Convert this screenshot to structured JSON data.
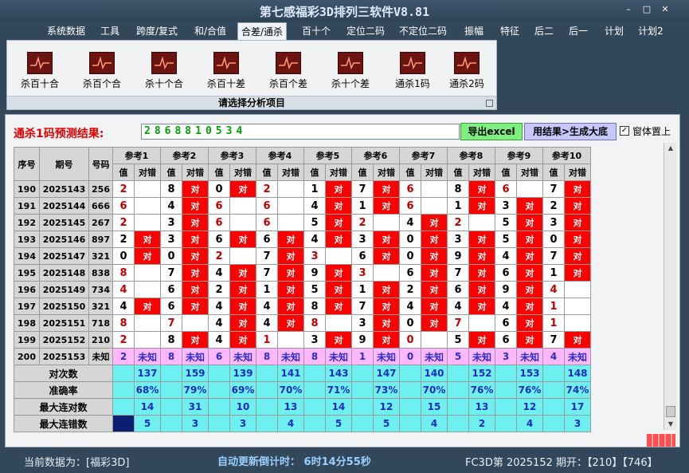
{
  "window": {
    "title": "第七感福彩3D排列三软件V8.81",
    "min_glyph": "–",
    "max_glyph": "□",
    "close_glyph": "✕"
  },
  "menu": [
    {
      "label": "系统数据"
    },
    {
      "label": "工具"
    },
    {
      "label": "跨度/复式"
    },
    {
      "label": "和/合值"
    },
    {
      "label": "合差/通杀",
      "active": true
    },
    {
      "label": "百十个"
    },
    {
      "label": "定位二码"
    },
    {
      "label": "不定位二码"
    },
    {
      "label": "振幅"
    },
    {
      "label": "特征"
    },
    {
      "label": "后二"
    },
    {
      "label": "后一"
    },
    {
      "label": "计划"
    },
    {
      "label": "计划2"
    }
  ],
  "ribbon": {
    "buttons": [
      {
        "label": "杀百十合",
        "icon": "chart-icon"
      },
      {
        "label": "杀百个合",
        "icon": "chart-icon"
      },
      {
        "label": "杀十个合",
        "icon": "chart-icon"
      },
      {
        "label": "杀百十差",
        "icon": "chart-icon"
      },
      {
        "label": "杀百个差",
        "icon": "chart-icon"
      },
      {
        "label": "杀十个差",
        "icon": "chart-icon"
      },
      {
        "label": "通杀1码",
        "icon": "chart-icon"
      },
      {
        "label": "通杀2码",
        "icon": "chart-icon"
      }
    ],
    "caption": "请选择分析项目"
  },
  "prediction": {
    "label": "通杀1码预测结果:",
    "value": "2868810534",
    "export_label": "导出excel",
    "generate_label": "用结果>生成大底",
    "always_on_top_label": "窗体置上",
    "always_on_top_checked": true
  },
  "table": {
    "headers": {
      "seq": "序号",
      "period": "期号",
      "code": "号码",
      "value": "值",
      "hit": "对错"
    },
    "refs": [
      "参考1",
      "参考2",
      "参考3",
      "参考4",
      "参考5",
      "参考6",
      "参考7",
      "参考8",
      "参考9",
      "参考10"
    ],
    "rows": [
      {
        "seq": "190",
        "period": "2025143",
        "code": "256",
        "cells": [
          [
            "2",
            "",
            ""
          ],
          [
            "8",
            "对",
            ""
          ],
          [
            "0",
            "对",
            ""
          ],
          [
            "2",
            "",
            ""
          ],
          [
            "1",
            "对",
            ""
          ],
          [
            "7",
            "对",
            ""
          ],
          [
            "6",
            "",
            ""
          ],
          [
            "8",
            "对",
            ""
          ],
          [
            "6",
            "",
            ""
          ],
          [
            "7",
            "对",
            ""
          ]
        ]
      },
      {
        "seq": "191",
        "period": "2025144",
        "code": "666",
        "cells": [
          [
            "6",
            "",
            ""
          ],
          [
            "4",
            "对",
            ""
          ],
          [
            "6",
            "",
            ""
          ],
          [
            "6",
            "",
            ""
          ],
          [
            "4",
            "对",
            ""
          ],
          [
            "1",
            "对",
            ""
          ],
          [
            "6",
            "",
            ""
          ],
          [
            "1",
            "对",
            ""
          ],
          [
            "3",
            "对",
            ""
          ],
          [
            "2",
            "对",
            ""
          ]
        ]
      },
      {
        "seq": "192",
        "period": "2025145",
        "code": "267",
        "cells": [
          [
            "2",
            "",
            ""
          ],
          [
            "3",
            "对",
            ""
          ],
          [
            "6",
            "",
            ""
          ],
          [
            "6",
            "",
            ""
          ],
          [
            "5",
            "对",
            ""
          ],
          [
            "2",
            "",
            ""
          ],
          [
            "4",
            "对",
            ""
          ],
          [
            "2",
            "",
            ""
          ],
          [
            "5",
            "对",
            ""
          ],
          [
            "3",
            "对",
            ""
          ]
        ]
      },
      {
        "seq": "193",
        "period": "2025146",
        "code": "897",
        "cells": [
          [
            "2",
            "对",
            ""
          ],
          [
            "3",
            "对",
            ""
          ],
          [
            "6",
            "对",
            ""
          ],
          [
            "6",
            "对",
            ""
          ],
          [
            "4",
            "对",
            ""
          ],
          [
            "3",
            "对",
            ""
          ],
          [
            "0",
            "对",
            ""
          ],
          [
            "3",
            "对",
            ""
          ],
          [
            "5",
            "对",
            ""
          ],
          [
            "0",
            "对",
            ""
          ]
        ]
      },
      {
        "seq": "194",
        "period": "2025147",
        "code": "321",
        "cells": [
          [
            "0",
            "对",
            ""
          ],
          [
            "0",
            "对",
            ""
          ],
          [
            "2",
            "",
            ""
          ],
          [
            "7",
            "对",
            ""
          ],
          [
            "3",
            "",
            ""
          ],
          [
            "6",
            "对",
            ""
          ],
          [
            "0",
            "对",
            ""
          ],
          [
            "9",
            "对",
            ""
          ],
          [
            "4",
            "对",
            ""
          ],
          [
            "7",
            "对",
            ""
          ]
        ]
      },
      {
        "seq": "195",
        "period": "2025148",
        "code": "838",
        "cells": [
          [
            "8",
            "",
            ""
          ],
          [
            "7",
            "对",
            ""
          ],
          [
            "4",
            "对",
            ""
          ],
          [
            "7",
            "对",
            ""
          ],
          [
            "9",
            "对",
            ""
          ],
          [
            "3",
            "",
            ""
          ],
          [
            "6",
            "对",
            ""
          ],
          [
            "7",
            "对",
            ""
          ],
          [
            "6",
            "对",
            ""
          ],
          [
            "1",
            "对",
            ""
          ]
        ]
      },
      {
        "seq": "196",
        "period": "2025149",
        "code": "734",
        "cells": [
          [
            "4",
            "",
            ""
          ],
          [
            "6",
            "对",
            ""
          ],
          [
            "2",
            "对",
            ""
          ],
          [
            "1",
            "对",
            ""
          ],
          [
            "5",
            "对",
            ""
          ],
          [
            "1",
            "对",
            ""
          ],
          [
            "2",
            "对",
            ""
          ],
          [
            "6",
            "对",
            ""
          ],
          [
            "9",
            "对",
            ""
          ],
          [
            "4",
            "",
            ""
          ]
        ]
      },
      {
        "seq": "197",
        "period": "2025150",
        "code": "321",
        "cells": [
          [
            "4",
            "对",
            ""
          ],
          [
            "6",
            "对",
            ""
          ],
          [
            "4",
            "对",
            ""
          ],
          [
            "4",
            "对",
            ""
          ],
          [
            "8",
            "对",
            ""
          ],
          [
            "7",
            "对",
            ""
          ],
          [
            "4",
            "对",
            ""
          ],
          [
            "4",
            "对",
            ""
          ],
          [
            "4",
            "对",
            ""
          ],
          [
            "1",
            "",
            ""
          ]
        ]
      },
      {
        "seq": "198",
        "period": "2025151",
        "code": "718",
        "cells": [
          [
            "8",
            "",
            ""
          ],
          [
            "7",
            "",
            ""
          ],
          [
            "4",
            "对",
            ""
          ],
          [
            "4",
            "对",
            ""
          ],
          [
            "8",
            "",
            ""
          ],
          [
            "3",
            "对",
            ""
          ],
          [
            "0",
            "对",
            ""
          ],
          [
            "7",
            "",
            ""
          ],
          [
            "6",
            "对",
            ""
          ],
          [
            "1",
            "",
            ""
          ]
        ]
      },
      {
        "seq": "199",
        "period": "2025152",
        "code": "210",
        "cells": [
          [
            "2",
            "",
            ""
          ],
          [
            "8",
            "对",
            ""
          ],
          [
            "4",
            "对",
            ""
          ],
          [
            "1",
            "",
            ""
          ],
          [
            "3",
            "对",
            ""
          ],
          [
            "9",
            "对",
            ""
          ],
          [
            "0",
            "",
            ""
          ],
          [
            "5",
            "对",
            ""
          ],
          [
            "6",
            "对",
            ""
          ],
          [
            "7",
            "对",
            ""
          ]
        ]
      }
    ],
    "pred_row": {
      "seq": "200",
      "period": "2025153",
      "code": "未知",
      "values": [
        "2",
        "8",
        "6",
        "8",
        "8",
        "1",
        "0",
        "5",
        "3",
        "4"
      ],
      "unknown": "未知"
    },
    "stats": [
      {
        "label": "对次数",
        "values": [
          "137",
          "159",
          "139",
          "141",
          "143",
          "147",
          "140",
          "152",
          "153",
          "148"
        ]
      },
      {
        "label": "准确率",
        "values": [
          "68%",
          "79%",
          "69%",
          "70%",
          "71%",
          "73%",
          "70%",
          "76%",
          "76%",
          "74%"
        ]
      },
      {
        "label": "最大连对数",
        "values": [
          "14",
          "31",
          "10",
          "13",
          "14",
          "12",
          "15",
          "13",
          "12",
          "17"
        ]
      },
      {
        "label": "最大连错数",
        "values": [
          "5",
          "3",
          "3",
          "4",
          "5",
          "5",
          "4",
          "2",
          "4",
          "3"
        ]
      }
    ]
  },
  "status": {
    "current_label": "当前数据为：[福彩3D]",
    "update_label": "自动更新倒计时：   6时14分55秒",
    "fc_label": "FC3D第 2025152 期开：【210】【746】"
  },
  "colors": {
    "hit": "#ff0000",
    "predict_row": "#ffb8ff",
    "stats": "#6ff0f0",
    "value_red": "#c00000",
    "value_black": "#000000"
  }
}
